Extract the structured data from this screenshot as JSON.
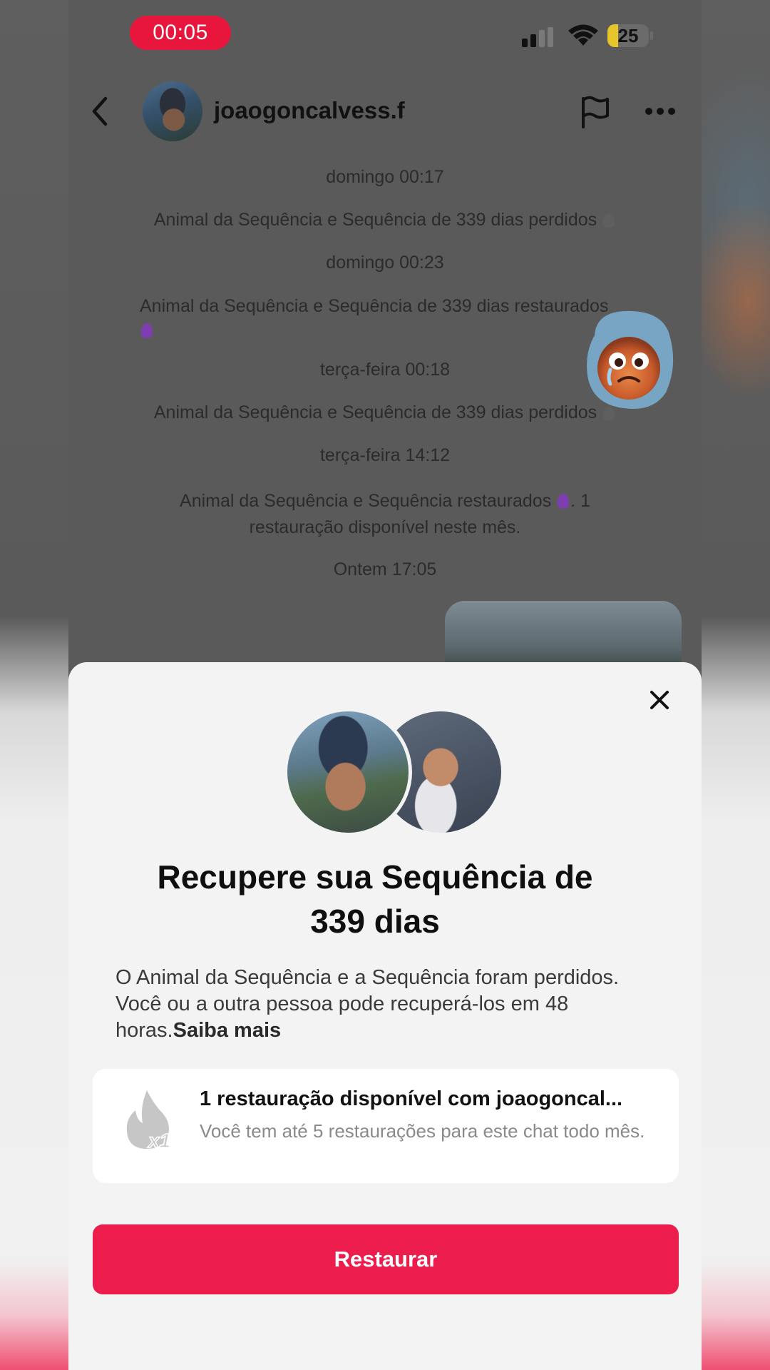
{
  "status_bar": {
    "timer": "00:05",
    "battery_level": "25"
  },
  "header": {
    "username": "joaogoncalvess.f"
  },
  "messages": [
    {
      "time": "domingo 00:17",
      "text": "Animal da Sequência e Sequência de 339 dias perdidos"
    },
    {
      "time": "domingo 00:23",
      "text": "Animal da Sequência e Sequência de 339 dias restaurados"
    },
    {
      "time": "terça-feira 00:18",
      "text": "Animal da Sequência e Sequência de 339 dias perdidos"
    },
    {
      "time": "terça-feira 14:12",
      "text_line1": "Animal da Sequência e Sequência restaurados",
      "text_suffix": ". 1",
      "text_line2": "restauração disponível neste mês."
    },
    {
      "time": "Ontem 17:05"
    }
  ],
  "sheet": {
    "title_line1": "Recupere sua Sequência de",
    "title_line2": "339 dias",
    "description": "O Animal da Sequência e a Sequência foram perdidos. Você ou a outra pessoa pode recuperá-los em 48 horas.",
    "learn_more": "Saiba mais",
    "card": {
      "badge": "x1",
      "title": "1 restauração disponível com joaogoncal...",
      "subtitle": "Você tem até 5 restaurações para este chat todo mês."
    },
    "restore_button": "Restaurar"
  },
  "colors": {
    "accent": "#ec1d4c",
    "timer_pill": "#e8163c",
    "battery_fill": "#e6c62a"
  }
}
